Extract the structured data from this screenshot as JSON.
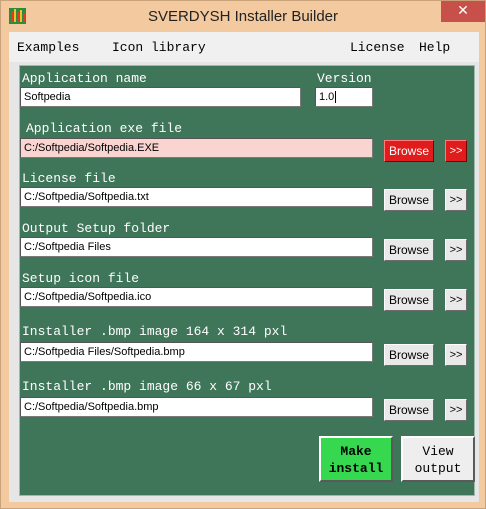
{
  "window": {
    "title": "SVERDYSH Installer Builder",
    "close_glyph": "✕"
  },
  "menu": {
    "examples": "Examples",
    "icon_library": "Icon library",
    "license": "License",
    "help": "Help"
  },
  "form": {
    "app_name_label": "Application name",
    "app_name_value": "Softpedia",
    "version_label": "Version",
    "version_value": "1.0",
    "exe_label": "Application exe file",
    "exe_value": "C:/Softpedia/Softpedia.EXE",
    "license_label": "License file",
    "license_value": "C:/Softpedia/Softpedia.txt",
    "output_label": "Output Setup folder",
    "output_value": "C:/Softpedia Files",
    "icon_label": "Setup icon file",
    "icon_value": "C:/Softpedia/Softpedia.ico",
    "bmp_large_label": "Installer .bmp image 164 x 314 pxl",
    "bmp_large_value": "C:/Softpedia Files/Softpedia.bmp",
    "bmp_small_label": "Installer .bmp image 66 x 67 pxl",
    "bmp_small_value": "C:/Softpedia/Softpedia.bmp"
  },
  "buttons": {
    "browse": "Browse",
    "more": ">>",
    "make_line1": "Make",
    "make_line2": "install",
    "view_line1": "View",
    "view_line2": "output"
  },
  "colors": {
    "panel": "#3f7559",
    "titlebar": "#f3c9a0",
    "alert_red": "#e01c1c",
    "make_green": "#35d84f",
    "exe_field": "#f9d4d1"
  },
  "icons": {
    "app": "installer-app-icon",
    "close": "close-icon"
  }
}
